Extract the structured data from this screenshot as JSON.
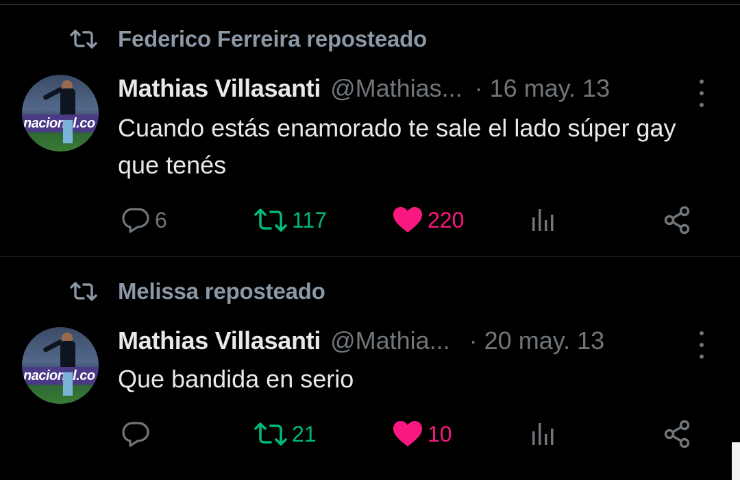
{
  "tweets": [
    {
      "reposted_by": "Federico Ferreira reposteado",
      "name": "Mathias Villasanti",
      "handle": "@Mathias...",
      "date": "· 16 may. 13",
      "text": "Cuando estás enamorado te sale el lado súper gay que tenés",
      "replies": "6",
      "reposts": "117",
      "likes": "220",
      "avatar_text": "nacional.co"
    },
    {
      "reposted_by": "Melissa reposteado",
      "name": "Mathias Villasanti",
      "handle": "@Mathia...",
      "date": "· 20 may. 13",
      "text": "Que bandida en serio",
      "replies": "",
      "reposts": "21",
      "likes": "10",
      "avatar_text": "nacional.co"
    }
  ],
  "icons": {
    "repost": "repost-icon",
    "reply": "reply-icon",
    "like": "heart-icon",
    "views": "bar-chart-icon",
    "share": "share-icon",
    "more": "more-icon"
  },
  "colors": {
    "background": "#000000",
    "muted": "#71767b",
    "repost_green": "#00ba7c",
    "like_pink": "#f91880"
  }
}
